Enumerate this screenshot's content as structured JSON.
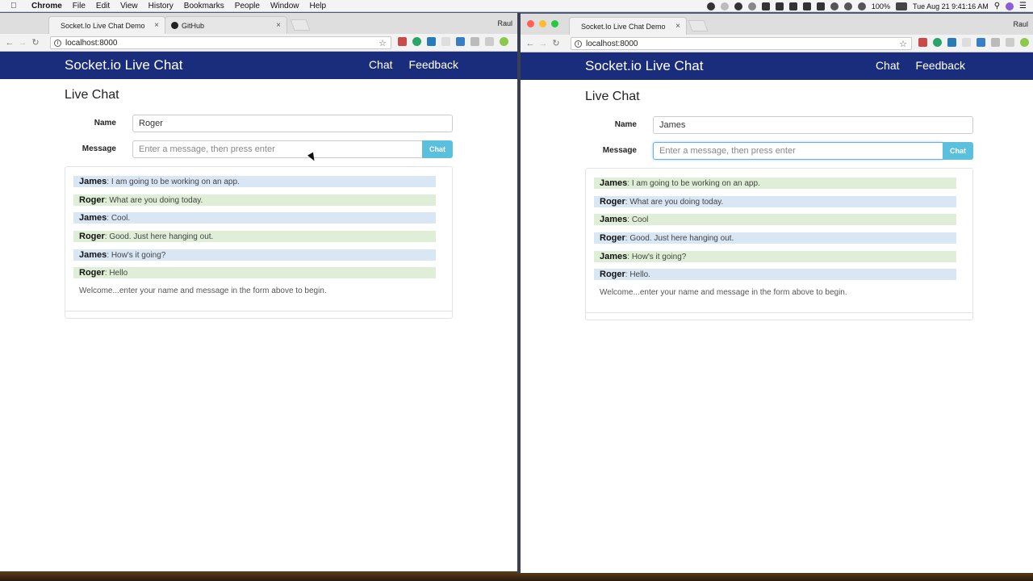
{
  "menubar": {
    "app": "Chrome",
    "items": [
      "File",
      "Edit",
      "View",
      "History",
      "Bookmarks",
      "People",
      "Window",
      "Help"
    ],
    "battery": "100%",
    "clock": "Tue Aug 21  9:41:16 AM"
  },
  "left": {
    "tabs": [
      {
        "title": "Socket.Io Live Chat Demo"
      },
      {
        "title": "GitHub"
      }
    ],
    "profile": "Raul",
    "url": "localhost:8000",
    "brand": "Socket.io Live Chat",
    "nav": [
      "Chat",
      "Feedback"
    ],
    "page_title": "Live Chat",
    "name_label": "Name",
    "name_value": "Roger",
    "message_label": "Message",
    "message_placeholder": "Enter a message, then press enter",
    "chat_button": "Chat",
    "messages": [
      {
        "author": "James",
        "text": ": I am going to be working on an app."
      },
      {
        "author": "Roger",
        "text": ": What are you doing today."
      },
      {
        "author": "James",
        "text": ": Cool."
      },
      {
        "author": "Roger",
        "text": ": Good. Just here hanging out."
      },
      {
        "author": "James",
        "text": ": How's it going?"
      },
      {
        "author": "Roger",
        "text": ": Hello"
      }
    ],
    "welcome": "Welcome...enter your name and message in the form above to begin."
  },
  "right": {
    "tabs": [
      {
        "title": "Socket.Io Live Chat Demo"
      }
    ],
    "profile": "Raul",
    "url": "localhost:8000",
    "brand": "Socket.io Live Chat",
    "nav": [
      "Chat",
      "Feedback"
    ],
    "page_title": "Live Chat",
    "name_label": "Name",
    "name_value": "James",
    "message_label": "Message",
    "message_placeholder": "Enter a message, then press enter",
    "chat_button": "Chat",
    "messages": [
      {
        "author": "James",
        "text": ": I am going to be working on an app."
      },
      {
        "author": "Roger",
        "text": ": What are you doing today."
      },
      {
        "author": "James",
        "text": ": Cool"
      },
      {
        "author": "Roger",
        "text": ": Good. Just here hanging out."
      },
      {
        "author": "James",
        "text": ": How's it going?"
      },
      {
        "author": "Roger",
        "text": ": Hello."
      }
    ],
    "welcome": "Welcome...enter your name and message in the form above to begin."
  },
  "colors": {
    "navbar": "#1a2d7c",
    "chat_button": "#5bc0de",
    "msg_blue": "#d9e7f5",
    "msg_green": "#dfeed6"
  }
}
